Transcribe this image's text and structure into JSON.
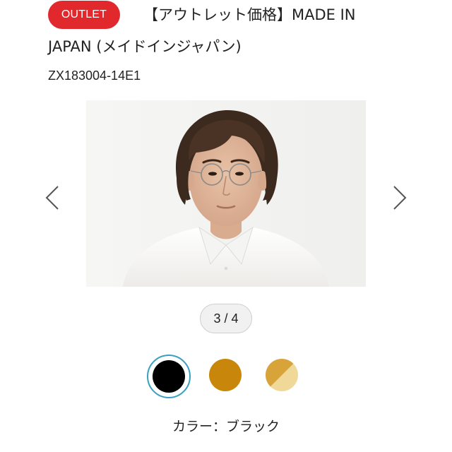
{
  "product": {
    "badge": "OUTLET",
    "title_line1": "【アウトレット価格】MADE IN",
    "title_line2": "JAPAN (メイドインジャパン)",
    "sku": "ZX183004-14E1"
  },
  "gallery": {
    "counter": "3 / 4",
    "current_index": 3,
    "total": 4,
    "prev_icon": "chevron-left-icon",
    "next_icon": "chevron-right-icon",
    "photo_subject": "model-wearing-round-glasses"
  },
  "colors": {
    "swatches": [
      {
        "name": "black-swatch",
        "color": "#000000",
        "selected": true
      },
      {
        "name": "amber-swatch",
        "color": "#c8860a",
        "selected": false
      },
      {
        "name": "gold-clear-swatch",
        "color_a": "#d8a43a",
        "color_b": "#f0d898",
        "selected": false
      }
    ],
    "label_prefix": "カラー：",
    "label_value": "ブラック",
    "label_full": "カラー：ブラック"
  },
  "theme": {
    "badge_color": "#e0282d",
    "selected_ring": "#3aa0c0",
    "counter_bg": "#f1f1f1"
  }
}
